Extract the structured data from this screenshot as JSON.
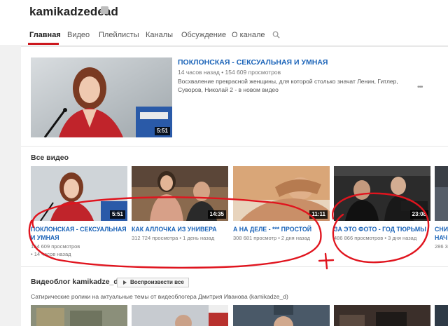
{
  "channel": {
    "name": "kamikadzedead"
  },
  "tabs": [
    {
      "label": "Главная",
      "active": true
    },
    {
      "label": "Видео"
    },
    {
      "label": "Плейлисты"
    },
    {
      "label": "Каналы"
    },
    {
      "label": "Обсуждение"
    },
    {
      "label": "О канале"
    }
  ],
  "featured": {
    "title": "ПОКЛОНСКАЯ - СЕКСУАЛЬНАЯ И УМНАЯ",
    "meta": "14 часов назад • 154 609 просмотров",
    "description": "Восхваление прекрасной женщины, для которой столько значат Ленин, Гитлер, Суворов, Николай 2 - в новом видео",
    "duration": "5:51",
    "more": "•••"
  },
  "all_videos": {
    "title": "Все видео",
    "videos": [
      {
        "title_line1": "ПОКЛОНСКАЯ - СЕКСУАЛЬНАЯ",
        "title_line2": "И УМНАЯ",
        "views": "154 609 просмотров",
        "age": "• 14 часов назад",
        "duration": "5:51"
      },
      {
        "title_line1": "КАК АЛЛОЧКА ИЗ УНИВЕРА",
        "meta": "312 724 просмотра • 1 день назад",
        "duration": "14:35"
      },
      {
        "title_line1": "А НА ДЕЛЕ - *** ПРОСТОЙ",
        "meta": "308 681 просмотр • 2 дня назад",
        "duration": "11:11"
      },
      {
        "title_line1": "ЗА ЭТО ФОТО - ГОД ТЮРЬМЫ",
        "meta": "486 866 просмотров • 3 дня назад",
        "duration": "23:08"
      },
      {
        "title_line1": "СНИ",
        "title_line2": "НАЧ",
        "meta": "286 3"
      }
    ]
  },
  "playlist": {
    "title": "Видеоблог kamikadze_d",
    "play_all": "Воспроизвести все",
    "description": "Сатирические ролики на актуальные темы от видеоблогера Дмитрия Иванова (kamikadze_d)"
  },
  "colors": {
    "link": "#1a63b8",
    "accent": "#cc181e",
    "annotation": "#e0141e"
  }
}
